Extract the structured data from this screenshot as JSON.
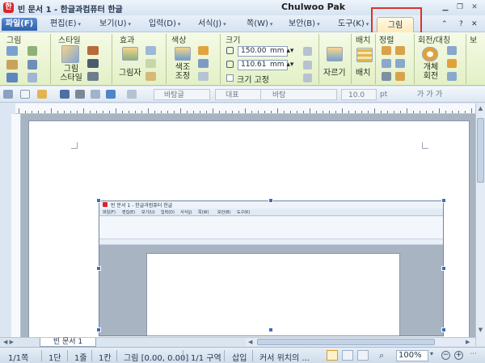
{
  "window": {
    "app_icon": "한",
    "title": "빈 문서 1 - 한글과컴퓨터 한글",
    "user": "Chulwoo Pak",
    "controls": [
      "minimize-icon",
      "restore-icon",
      "close-icon"
    ]
  },
  "menubar": {
    "file": "파일(F)",
    "items": [
      {
        "label": "편집(E)"
      },
      {
        "label": "보기(U)"
      },
      {
        "label": "입력(D)"
      },
      {
        "label": "서식(J)"
      },
      {
        "label": "쪽(W)"
      },
      {
        "label": "보안(B)"
      },
      {
        "label": "도구(K)"
      }
    ],
    "picture_tab": "그림",
    "right_icons": [
      "ribbon-collapse-icon",
      "help-icon",
      "close-doc-icon"
    ]
  },
  "ribbon": {
    "groups": {
      "picture": "그림",
      "style": "스타일",
      "effect": "효과",
      "color": "색상",
      "size": "크기",
      "arrange": "배치",
      "align": "정렬",
      "rotate": "회전/대칭",
      "extra": "보"
    },
    "labels": {
      "picture_style": "그림\n스타일",
      "shadow": "그림자",
      "color_adjust": "색조\n조정",
      "crop": "자르기",
      "layout": "배치",
      "object_rotate": "개체\n회전"
    },
    "width_value": "150.00",
    "height_value": "110.61",
    "unit": "mm",
    "lock_size": "크기 고정"
  },
  "toolbar": {
    "style_box": "바탕글",
    "style_placeholder": "대표",
    "font_box": "바탕",
    "size_box": "10.0",
    "size_unit": "pt",
    "format_glyphs": "가 가 가"
  },
  "document": {
    "tab_label": "빈 문서 1"
  },
  "statusbar": {
    "page": "1/1쪽",
    "column": "1단",
    "line": "1줄",
    "char": "1칸",
    "object": "그림 [0.00, 0.00]",
    "section": "1/1 구역",
    "mode": "삽입",
    "hint": "커서 위치의 ...",
    "zoom": "100%"
  },
  "embedded_screenshot": {
    "title": "빈 문서 1 - 한글과컴퓨터 한글",
    "menus": [
      "파일(F)",
      "편집(E)",
      "보기(U)",
      "입력(D)",
      "서식(J)",
      "쪽(W)",
      "보안(B)",
      "도구(K)"
    ]
  }
}
